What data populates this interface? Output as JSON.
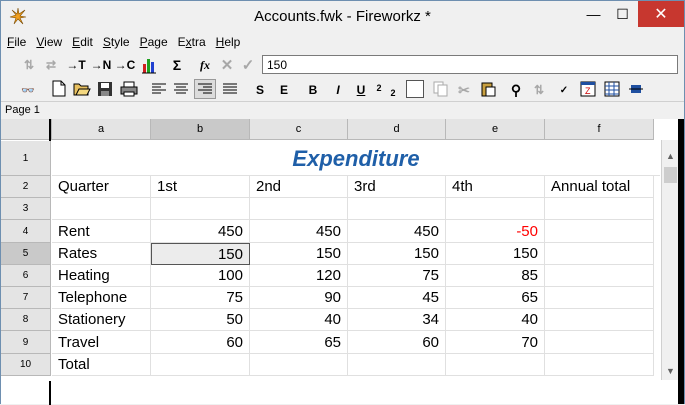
{
  "window": {
    "title": "Accounts.fwk - Fireworkz *"
  },
  "menu": [
    {
      "label": "File",
      "key": "F"
    },
    {
      "label": "View",
      "key": "V"
    },
    {
      "label": "Edit",
      "key": "E"
    },
    {
      "label": "Style",
      "key": "S"
    },
    {
      "label": "Page",
      "key": "P"
    },
    {
      "label": "Extra",
      "key": "x"
    },
    {
      "label": "Help",
      "key": "H"
    }
  ],
  "toolbar1": {
    "labels": [
      "→T",
      "→N",
      "→C",
      "Σ",
      "fx"
    ],
    "formula_value": "150"
  },
  "toolbar2": {
    "style_labels": [
      "S",
      "E",
      "B",
      "I",
      "U",
      "2",
      "2"
    ]
  },
  "pagebar": {
    "label": "Page 1"
  },
  "grid": {
    "columns": [
      "a",
      "b",
      "c",
      "d",
      "e",
      "f"
    ],
    "selected_column": "b",
    "rows": [
      "1",
      "2",
      "3",
      "4",
      "5",
      "6",
      "7",
      "8",
      "9",
      "10"
    ],
    "selected_row": "5",
    "title": "Expenditure",
    "header_row": [
      "Quarter",
      "1st",
      "2nd",
      "3rd",
      "4th",
      "Annual total"
    ],
    "data": [
      {
        "label": "",
        "values": [
          "",
          "",
          "",
          ""
        ]
      },
      {
        "label": "Rent",
        "values": [
          "450",
          "450",
          "450",
          "-50"
        ]
      },
      {
        "label": "Rates",
        "values": [
          "150",
          "150",
          "150",
          "150"
        ]
      },
      {
        "label": "Heating",
        "values": [
          "100",
          "120",
          "75",
          "85"
        ]
      },
      {
        "label": "Telephone",
        "values": [
          "75",
          "90",
          "45",
          "65"
        ]
      },
      {
        "label": "Stationery",
        "values": [
          "50",
          "40",
          "34",
          "40"
        ]
      },
      {
        "label": "Travel",
        "values": [
          "60",
          "65",
          "60",
          "70"
        ]
      },
      {
        "label": "Total",
        "values": [
          "",
          "",
          "",
          ""
        ]
      }
    ]
  },
  "colors": {
    "title": "#1f5fa8",
    "negative": "#ff0000",
    "close_button": "#c7372f"
  }
}
